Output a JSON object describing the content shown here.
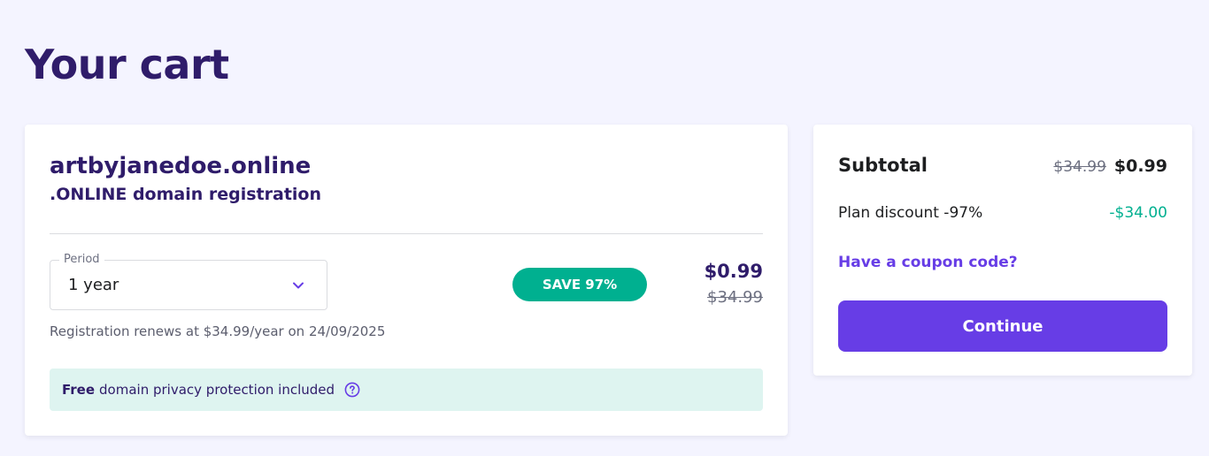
{
  "page": {
    "title": "Your cart"
  },
  "cart_item": {
    "domain": "artbyjanedoe.online",
    "product": ".ONLINE domain registration",
    "period": {
      "label": "Period",
      "value": "1 year",
      "icon": "chevron-down-icon"
    },
    "renewal_note": "Registration renews at $34.99/year on 24/09/2025",
    "save_badge": "SAVE 97%",
    "price_now": "$0.99",
    "price_old": "$34.99",
    "privacy": {
      "strong": "Free",
      "text": "domain privacy protection included",
      "icon": "question-circle-icon"
    }
  },
  "summary": {
    "subtotal_label": "Subtotal",
    "subtotal_old": "$34.99",
    "subtotal_now": "$0.99",
    "discount_label": "Plan discount -97%",
    "discount_value": "-$34.00",
    "coupon_link": "Have a coupon code?",
    "continue_label": "Continue"
  },
  "colors": {
    "background": "#f4f4ff",
    "heading": "#2f1c6a",
    "accent": "#673de6",
    "success": "#00b090",
    "privacy_bg": "#def4f0"
  }
}
